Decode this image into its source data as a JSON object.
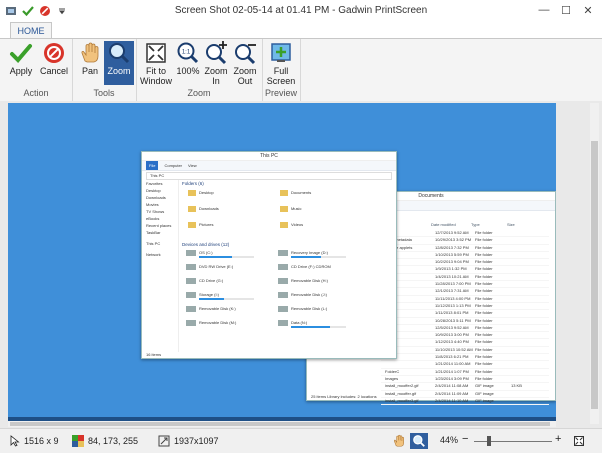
{
  "window": {
    "title": "Screen Shot 02-05-14 at 01.41 PM - Gadwin PrintScreen",
    "minimize": "—",
    "maximize": "☐",
    "close": "✕"
  },
  "tabs": [
    {
      "label": "HOME"
    }
  ],
  "ribbon": {
    "groups": [
      {
        "label": "Action",
        "buttons": [
          {
            "label": "Apply"
          },
          {
            "label": "Cancel"
          }
        ]
      },
      {
        "label": "Tools",
        "buttons": [
          {
            "label": "Pan"
          },
          {
            "label": "Zoom"
          }
        ]
      },
      {
        "label": "Zoom",
        "buttons": [
          {
            "label": "Fit to Window"
          },
          {
            "label": "100%"
          },
          {
            "label": "Zoom In"
          },
          {
            "label": "Zoom Out"
          }
        ]
      },
      {
        "label": "Preview",
        "buttons": [
          {
            "label": "Full Screen"
          }
        ]
      }
    ]
  },
  "screenshot": {
    "this_pc": {
      "title": "This PC",
      "tabs": [
        "File",
        "Computer",
        "View"
      ],
      "address": "This PC",
      "nav": [
        "Favorites",
        "Desktop",
        "Downloads",
        "Movies",
        "TV Shows",
        "eBooks",
        "Recent places",
        "TaskBar",
        "This PC",
        "Network"
      ],
      "folders_header": "Folders (6)",
      "folders": [
        "Desktop",
        "Documents",
        "Downloads",
        "Music",
        "Pictures",
        "Videos"
      ],
      "drives_header": "Devices and drives (12)",
      "drives": [
        {
          "name": "OS (C:)",
          "fill": 0.6
        },
        {
          "name": "Recovery Image (D:)",
          "fill": 0.55
        },
        {
          "name": "DVD RW Drive (E:)",
          "fill": 0
        },
        {
          "name": "CD Drive (F:) CDROM",
          "fill": 0
        },
        {
          "name": "CD Drive (G:)",
          "fill": 0
        },
        {
          "name": "Removable Disk (H:)",
          "fill": 0
        },
        {
          "name": "Storage (I:)",
          "fill": 0.45
        },
        {
          "name": "Removable Disk (J:)",
          "fill": 0
        },
        {
          "name": "Removable Disk (K:)",
          "fill": 0
        },
        {
          "name": "Removable Disk (L:)",
          "fill": 0
        },
        {
          "name": "Removable Disk (M:)",
          "fill": 0
        },
        {
          "name": "Data (N:)",
          "fill": 0.7
        }
      ],
      "status": "16 items"
    },
    "documents": {
      "title": "Documents",
      "columns": [
        "Name",
        "Date modified",
        "Type",
        "Size"
      ],
      "rows": [
        {
          "name": "",
          "date": "12/7/2013 9:52 AM",
          "type": "File folder"
        },
        {
          "name": "ange-metadata",
          "date": "10/29/2013 3:52 PM",
          "type": "File folder"
        },
        {
          "name": "andage applets",
          "date": "12/8/2013 7:32 PM",
          "type": "File folder"
        },
        {
          "name": "",
          "date": "1/10/2013 5:59 PM",
          "type": "File folder"
        },
        {
          "name": "",
          "date": "10/2/2013 9:04 PM",
          "type": "File folder"
        },
        {
          "name": "",
          "date": "1/9/2013 1:32 PM",
          "type": "File folder"
        },
        {
          "name": "",
          "date": "1/4/2013 10:21 AM",
          "type": "File folder"
        },
        {
          "name": "",
          "date": "11/28/2013 7:00 PM",
          "type": "File folder"
        },
        {
          "name": "",
          "date": "12/1/2013 7:31 AM",
          "type": "File folder"
        },
        {
          "name": "",
          "date": "11/11/2013 4:00 PM",
          "type": "File folder"
        },
        {
          "name": "",
          "date": "11/12/2013 1:13 PM",
          "type": "File folder"
        },
        {
          "name": "",
          "date": "1/11/2013 8:01 PM",
          "type": "File folder"
        },
        {
          "name": "",
          "date": "10/28/2013 5:11 PM",
          "type": "File folder"
        },
        {
          "name": "",
          "date": "12/5/2013 9:52 AM",
          "type": "File folder"
        },
        {
          "name": "",
          "date": "10/9/2013 3:00 PM",
          "type": "File folder"
        },
        {
          "name": "",
          "date": "1/12/2013 4:40 PM",
          "type": "File folder"
        },
        {
          "name": "",
          "date": "11/10/2013 10:52 AM",
          "type": "File folder"
        },
        {
          "name": "",
          "date": "11/8/2013 6:21 PM",
          "type": "File folder"
        },
        {
          "name": "",
          "date": "1/21/2014 11:00 AM",
          "type": "File folder"
        },
        {
          "name": "FolderC",
          "date": "1/21/2014 1:07 PM",
          "type": "File folder"
        },
        {
          "name": "Images",
          "date": "1/23/2014 3:09 PM",
          "type": "File folder"
        },
        {
          "name": "install_mooffer2.gif",
          "date": "2/4/2014 11:08 AM",
          "type": "GIF image",
          "size": "13 KB"
        },
        {
          "name": "install_mooffer.gif",
          "date": "2/4/2014 11:09 AM",
          "type": "GIF image"
        },
        {
          "name": "install_mooffer3.gif",
          "date": "2/4/2014 11:10 AM",
          "type": "GIF image"
        }
      ],
      "status": "25 items   Library includes: 2 locations"
    }
  },
  "status": {
    "cursor_pos": "1516 x 9",
    "color_value": "84, 173, 255",
    "image_size": "1937x1097",
    "zoom_percent": "44%",
    "zoom_fill": 0.18
  },
  "colors": {
    "accent": "#2f5e9e",
    "canvas_bg": "#3f8fd9",
    "sampled_color": "#54adff"
  }
}
